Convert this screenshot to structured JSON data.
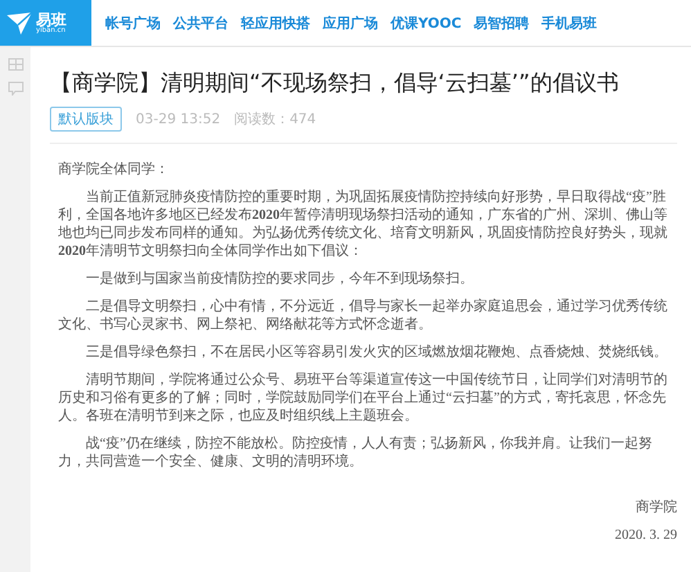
{
  "header": {
    "logo": {
      "name": "易班",
      "domain": "yiban.cn"
    },
    "nav": [
      "帐号广场",
      "公共平台",
      "轻应用快搭",
      "应用广场",
      "优课YOOC",
      "易智招聘",
      "手机易班"
    ]
  },
  "article": {
    "title": "【商学院】清明期间“不现场祭扫，倡导‘云扫墓’”的倡议书",
    "tag": "默认版块",
    "time": "03-29 13:52",
    "reads": "阅读数：474",
    "body": [
      {
        "kind": "salutation",
        "text": "商学院全体同学："
      },
      {
        "kind": "paragraph",
        "text": "当前正值新冠肺炎疫情防控的重要时期，为巩固拓展疫情防控持续向好形势，早日取得战“疫”胜利，全国各地许多地区已经发布**2020**年暂停清明现场祭扫活动的通知，广东省的广州、深圳、佛山等地也均已同步发布同样的通知。为弘扬优秀传统文化、培育文明新风，巩固疫情防控良好势头，现就**2020**年清明节文明祭扫向全体同学作出如下倡议："
      },
      {
        "kind": "paragraph",
        "text": "一是做到与国家当前疫情防控的要求同步，今年不到现场祭扫。"
      },
      {
        "kind": "paragraph",
        "text": "二是倡导文明祭扫，心中有情，不分远近，倡导与家长一起举办家庭追思会，通过学习优秀传统文化、书写心灵家书、网上祭祀、网络献花等方式怀念逝者。"
      },
      {
        "kind": "paragraph",
        "text": "三是倡导绿色祭扫，不在居民小区等容易引发火灾的区域燃放烟花鞭炮、点香烧烛、焚烧纸钱。"
      },
      {
        "kind": "paragraph",
        "text": "清明节期间，学院将通过公众号、易班平台等渠道宣传这一中国传统节日，让同学们对清明节的历史和习俗有更多的了解；同时，学院鼓励同学们在平台上通过“云扫墓”的方式，寄托哀思，怀念先人。各班在清明节到来之际，也应及时组织线上主题班会。"
      },
      {
        "kind": "paragraph",
        "text": "战“疫”仍在继续，防控不能放松。防控疫情，人人有责；弘扬新风，你我并肩。让我们一起努力，共同营造一个安全、健康、文明的清明环境。"
      },
      {
        "kind": "signature",
        "text": "商学院"
      },
      {
        "kind": "signature",
        "text": "2020. 3. 29"
      }
    ]
  }
}
